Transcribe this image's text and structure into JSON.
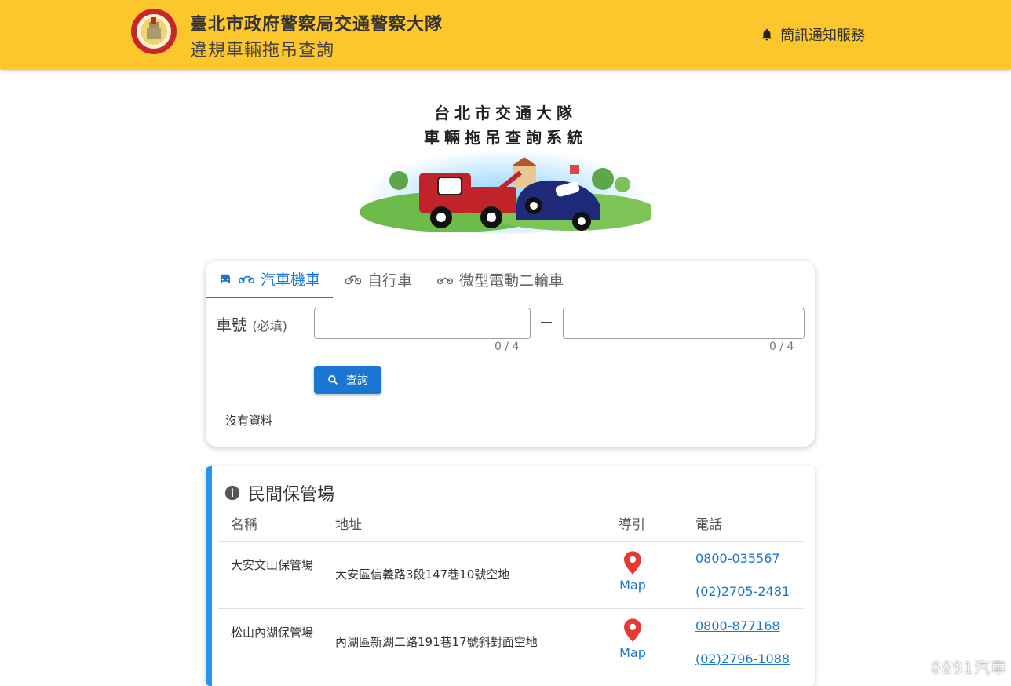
{
  "header": {
    "title": "臺北市政府警察局交通警察大隊",
    "subtitle": "違規車輛拖吊查詢",
    "sms_label": "簡訊通知服務",
    "icons": [
      "police-badge-logo",
      "bell-icon"
    ]
  },
  "banner": {
    "line1": "台北市交通大隊",
    "line2": "車輛拖吊查詢系統"
  },
  "search": {
    "tabs": [
      {
        "label": "汽車機車",
        "active": true,
        "icons": [
          "car-icon",
          "motorcycle-icon"
        ]
      },
      {
        "label": "自行車",
        "active": false,
        "icons": [
          "bicycle-icon"
        ]
      },
      {
        "label": "微型電動二輪車",
        "active": false,
        "icons": [
          "scooter-icon"
        ]
      }
    ],
    "plate_label": "車號",
    "plate_required": "(必填)",
    "plate_part1_value": "",
    "plate_part2_value": "",
    "counter1": "0 / 4",
    "counter2": "0 / 4",
    "search_button": "查詢",
    "result_text": "沒有資料"
  },
  "storage": {
    "title": "民間保管場",
    "columns": [
      "名稱",
      "地址",
      "導引",
      "電話"
    ],
    "rows": [
      {
        "name": "大安文山保管場",
        "address": "大安區信義路3段147巷10號空地",
        "map_label": "Map",
        "phones": [
          "0800-035567",
          "(02)2705-2481"
        ]
      },
      {
        "name": "松山內湖保管場",
        "address": "內湖區新湖二路191巷17號斜對面空地",
        "map_label": "Map",
        "phones": [
          "0800-877168",
          "(02)2796-1088"
        ]
      }
    ]
  },
  "watermark": "8891汽車",
  "colors": {
    "header_bg": "#fcc62d",
    "primary": "#1976d2",
    "accent_border": "#2196f3",
    "map_pin": "#e53935"
  }
}
